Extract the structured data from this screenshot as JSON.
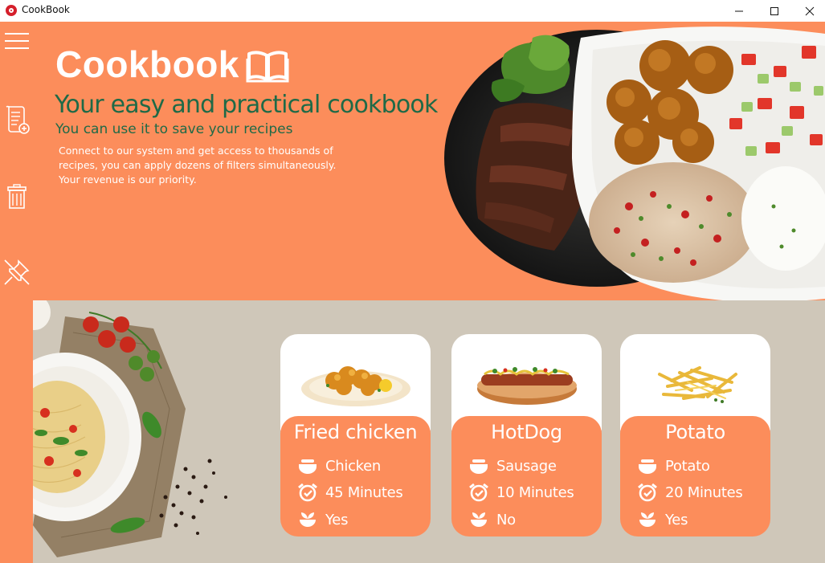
{
  "window": {
    "title": "CookBook",
    "controls": {
      "minimize": "minimize",
      "maximize": "maximize",
      "close": "close"
    }
  },
  "sidebar": {
    "items": [
      {
        "name": "menu",
        "icon": "hamburger-menu-icon"
      },
      {
        "name": "add-recipe",
        "icon": "add-document-icon"
      },
      {
        "name": "delete-recipe",
        "icon": "trash-icon"
      },
      {
        "name": "unpin",
        "icon": "unpin-icon"
      }
    ]
  },
  "hero": {
    "brand_title": "Cookbook",
    "tagline": "Your easy and practical cookbook",
    "subtagline": "You can use it to save your recipes",
    "description": "Connect to our system and get access to thousands of recipes, you can apply dozens of filters simultaneously. Your revenue is our priority."
  },
  "colors": {
    "accent": "#fc8d5b",
    "tagline_green": "#1f6a47",
    "lower_bg": "#cfc7b9"
  },
  "cards": [
    {
      "title": "Fried chicken",
      "ingredient": "Chicken",
      "time": "45 Minutes",
      "flag": "Yes"
    },
    {
      "title": "HotDog",
      "ingredient": "Sausage",
      "time": "10 Minutes",
      "flag": "No"
    },
    {
      "title": "Potato",
      "ingredient": "Potato",
      "time": "20 Minutes",
      "flag": "Yes"
    }
  ]
}
